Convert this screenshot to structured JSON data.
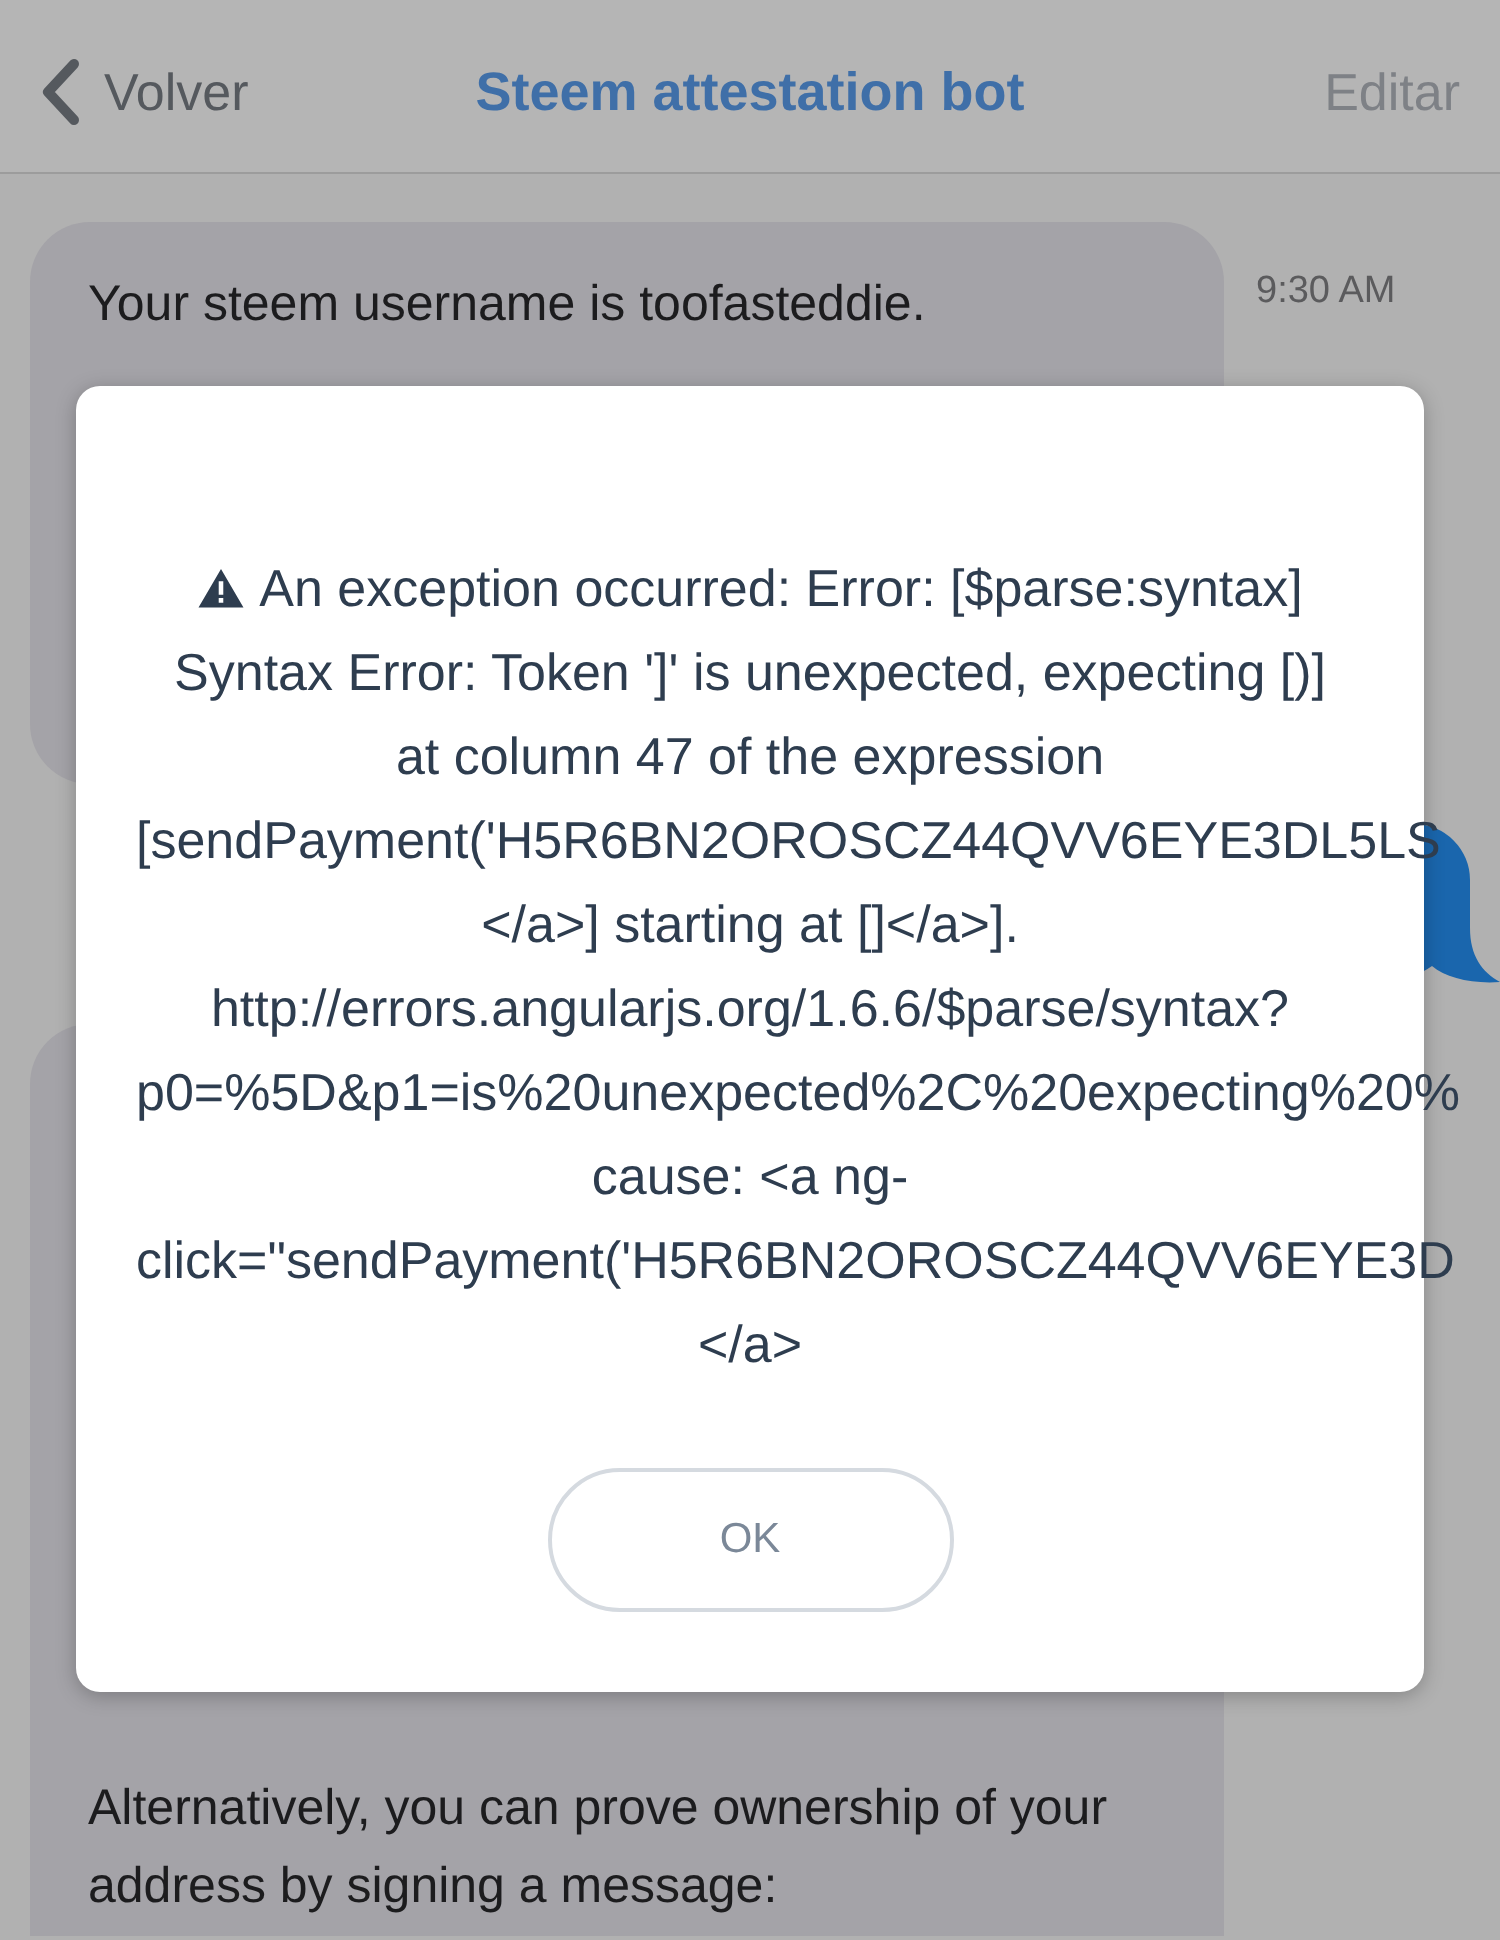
{
  "header": {
    "back_label": "Volver",
    "title": "Steem attestation bot",
    "action_label": "Editar"
  },
  "messages": [
    {
      "kind": "received",
      "text": "Your steem username is toofasteddie.",
      "time": "9:30 AM"
    },
    {
      "kind": "sent"
    },
    {
      "kind": "received",
      "text": "Alternatively, you can prove ownership of your address by signing a message:"
    }
  ],
  "error_dialog": {
    "lines": [
      {
        "kind": "warning",
        "text": "An exception occurred: Error: [$parse:syntax]"
      },
      {
        "kind": "plain",
        "text": "Syntax Error: Token ']' is unexpected, expecting [)]"
      },
      {
        "kind": "plain",
        "text": "at column 47 of the expression"
      },
      {
        "kind": "plain",
        "text": "[sendPayment('H5R6BN2OROSCZ44QVV6EYE3DL5LS"
      },
      {
        "kind": "plain",
        "text": "</a>] starting at []</a>]."
      },
      {
        "kind": "plain",
        "text": "http://errors.angularjs.org/1.6.6/$parse/syntax?"
      },
      {
        "kind": "plain",
        "text": "p0=%5D&p1=is%20unexpected%2C%20expecting%20%"
      },
      {
        "kind": "plain",
        "text": "cause: <a ng-"
      },
      {
        "kind": "plain",
        "text": "click=\"sendPayment('H5R6BN2OROSCZ44QVV6EYE3D"
      },
      {
        "kind": "plain",
        "text": "</a>"
      }
    ],
    "button": "OK"
  }
}
